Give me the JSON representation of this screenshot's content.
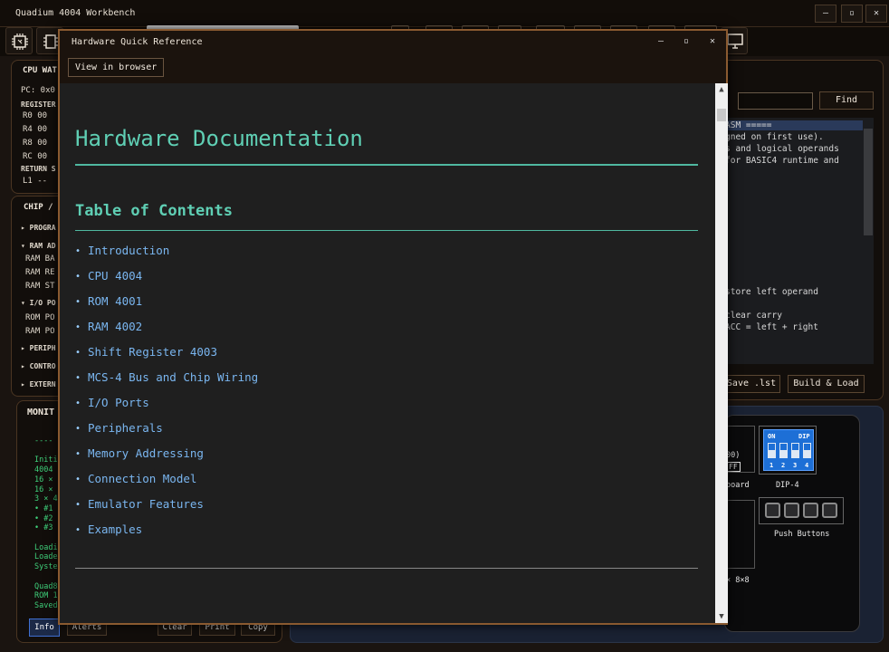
{
  "app": {
    "title": "Quadium 4004 Workbench",
    "window_controls": {
      "minimize": "–",
      "maximize": "▫",
      "close": "✕"
    }
  },
  "cpu_watch": {
    "title": "CPU WAT",
    "pc": "PC: 0x0",
    "registers_header": "REGISTER",
    "registers": [
      "R0  00",
      "R4  00",
      "R8  00",
      "RC  00"
    ],
    "return_stack_header": "RETURN S",
    "stack_line": "L1  --"
  },
  "chip": {
    "title": "CHIP /",
    "sections": [
      {
        "header": "PROGRA",
        "expanded": false,
        "items": []
      },
      {
        "header": "RAM AD",
        "expanded": true,
        "items": [
          "RAM BA",
          "RAM RE",
          "RAM ST"
        ]
      },
      {
        "header": "I/O PO",
        "expanded": true,
        "items": [
          "ROM PO",
          "RAM PO"
        ]
      },
      {
        "header": "PERIPH",
        "expanded": false,
        "items": []
      },
      {
        "header": "CONTRO",
        "expanded": false,
        "items": []
      },
      {
        "header": "EXTERN",
        "expanded": false,
        "items": []
      }
    ]
  },
  "monitor": {
    "title": "MONIT",
    "lines": [
      "----",
      "",
      "Initi",
      "4004",
      "16 ×",
      "16 ×",
      "3 × 4",
      "• #1",
      "• #2",
      "• #3",
      "",
      "Loadi",
      "Loade",
      "Syste",
      "",
      "Quad8",
      "ROM 1",
      "Saved"
    ],
    "tabs": {
      "info": "Info",
      "alerts": "Alerts"
    },
    "actions": {
      "clear": "Clear",
      "print": "Print",
      "copy": "Copy"
    }
  },
  "editor": {
    "find_button": "Find",
    "find_value": "",
    "lines": [
      {
        "text": "ASM =====",
        "highlight": true
      },
      {
        "text": "gned on first use).",
        "highlight": false
      },
      {
        "text": "s and logical operands",
        "highlight": false
      },
      {
        "text": "for BASIC4 runtime and",
        "highlight": false
      },
      {
        "text": "store left operand",
        "highlight": false
      },
      {
        "text": "clear carry",
        "highlight": false
      },
      {
        "text": "ACC = left + right",
        "highlight": false
      }
    ],
    "save_button": "Save .lst",
    "build_button": "Build & Load"
  },
  "peripherals": {
    "partial_value": "00)",
    "partial_state": "FF",
    "keyboard_label": "board",
    "dip_label": "DIP-4",
    "dip_on": "ON",
    "dip_tag": "DIP",
    "dip_numbers": [
      "1",
      "2",
      "3",
      "4"
    ],
    "dip_states": [
      true,
      true,
      true,
      true
    ],
    "push_buttons_label": "Push Buttons",
    "matrix_label": "× 8×8"
  },
  "dialog": {
    "title": "Hardware Quick Reference",
    "view_in_browser": "View in browser",
    "controls": {
      "minimize": "–",
      "maximize": "▫",
      "close": "✕"
    },
    "doc": {
      "heading": "Hardware Documentation",
      "toc_heading": "Table of Contents",
      "toc": [
        "Introduction",
        "CPU 4004",
        "ROM 4001",
        "RAM 4002",
        "Shift Register 4003",
        "MCS-4 Bus and Chip Wiring",
        "I/O Ports",
        "Peripherals",
        "Memory Addressing",
        "Connection Model",
        "Emulator Features",
        "Examples"
      ]
    }
  }
}
